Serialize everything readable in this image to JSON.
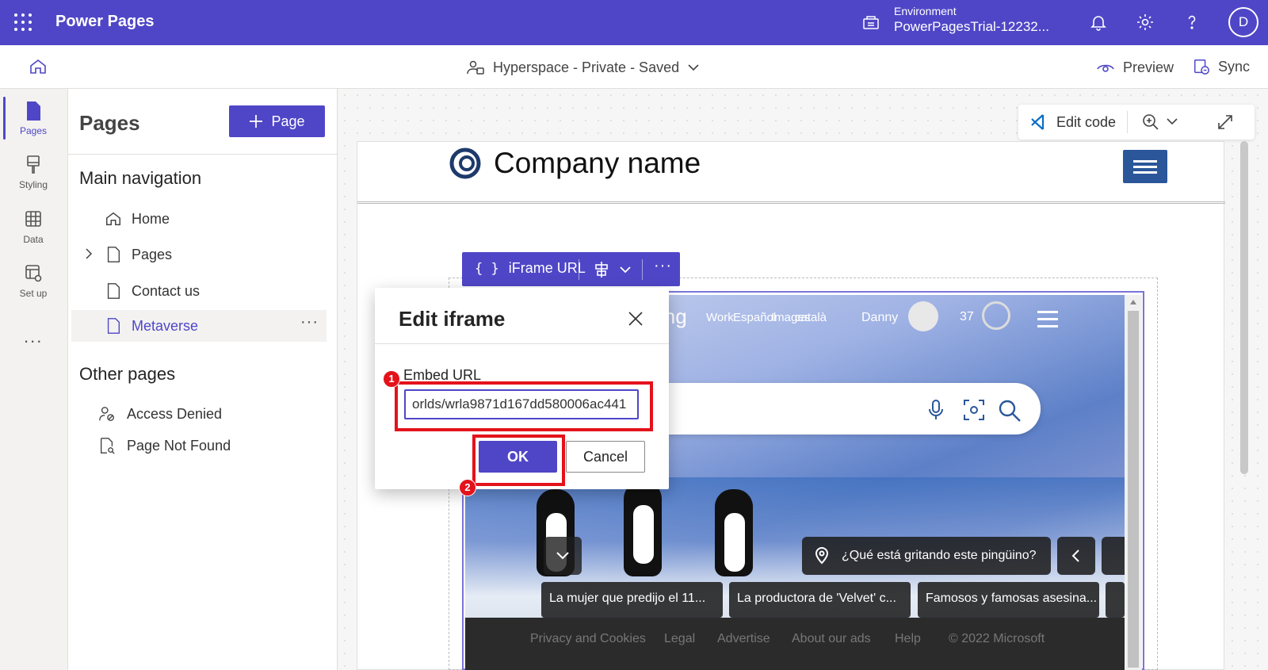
{
  "header": {
    "app_title": "Power Pages",
    "environment_label": "Environment",
    "environment_value": "PowerPagesTrial-12232...",
    "avatar_initial": "D"
  },
  "subbar": {
    "site_status": "Hyperspace - Private - Saved",
    "preview_label": "Preview",
    "sync_label": "Sync"
  },
  "rail": {
    "items": [
      {
        "label": "Pages",
        "icon": "page-icon"
      },
      {
        "label": "Styling",
        "icon": "brush-icon"
      },
      {
        "label": "Data",
        "icon": "table-icon"
      },
      {
        "label": "Set up",
        "icon": "settings-grid-icon"
      }
    ],
    "more": "..."
  },
  "pages_panel": {
    "title": "Pages",
    "add_button": "Page",
    "main_nav_title": "Main navigation",
    "main_nav": [
      {
        "label": "Home",
        "icon": "home-icon"
      },
      {
        "label": "Pages",
        "icon": "page-icon",
        "expandable": true
      },
      {
        "label": "Contact us",
        "icon": "page-icon"
      },
      {
        "label": "Metaverse",
        "icon": "page-icon",
        "selected": true
      }
    ],
    "other_pages_title": "Other pages",
    "other_pages": [
      {
        "label": "Access Denied",
        "icon": "person-lock-icon"
      },
      {
        "label": "Page Not Found",
        "icon": "page-search-icon"
      }
    ]
  },
  "canvas_toolbar": {
    "edit_code": "Edit code"
  },
  "site": {
    "company_name": "Company name"
  },
  "iframe_toolbar": {
    "label": "iFrame URL"
  },
  "bing": {
    "logo_fragment": "ing",
    "nav": [
      "Work",
      "Español",
      "Images",
      "català"
    ],
    "user": "Danny",
    "points": "37",
    "question": "¿Qué está gritando este pingüino?",
    "news": [
      "La mujer que predijo el 11...",
      "La productora de 'Velvet' c...",
      "Famosos y famosas asesina..."
    ],
    "footer": [
      "Privacy and Cookies",
      "Legal",
      "Advertise",
      "About our ads",
      "Help",
      "© 2022 Microsoft"
    ]
  },
  "dialog": {
    "title": "Edit iframe",
    "embed_label": "Embed URL",
    "embed_value": "orlds/wrla9871d167dd580006ac441",
    "ok": "OK",
    "cancel": "Cancel"
  },
  "annotations": {
    "step1": "1",
    "step2": "2",
    "highlight_color": "#e4121b"
  },
  "colors": {
    "brand": "#4f46c7",
    "hamburger": "#2b579a"
  }
}
